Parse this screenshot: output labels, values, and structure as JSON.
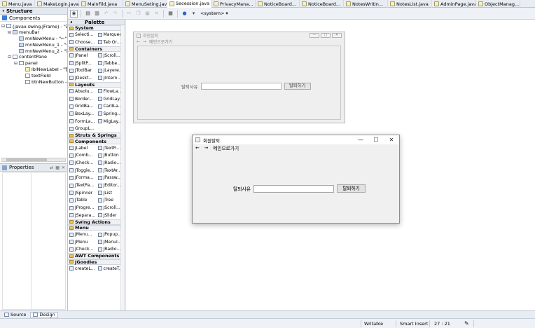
{
  "editor_tabs": [
    "Menu.java",
    "MakeLogin.java",
    "MainFild.java",
    "MenuSeting.java",
    "Secession.java",
    "PrivacyMana...",
    "NoticeBoard...",
    "NoticeBoard...",
    "NotesWritin...",
    "NotesList.java",
    "AdminPage.java",
    "ObjectManag..."
  ],
  "active_tab_close": "✕",
  "structure": {
    "title": "Structure",
    "components_label": "Components",
    "tree": [
      {
        "label": "(javax.swing.JFrame) - \"회원",
        "indent": 0,
        "exp": "⊟",
        "kind": "frame"
      },
      {
        "label": "menuBar",
        "indent": 1,
        "exp": "⊟",
        "kind": "menu"
      },
      {
        "label": "mnNewMenu - \"←\"",
        "indent": 2,
        "exp": "",
        "kind": "menu"
      },
      {
        "label": "mnNewMenu_1 - \"→\"",
        "indent": 2,
        "exp": "",
        "kind": "menu"
      },
      {
        "label": "mnNewMenu_2 - \"메인",
        "indent": 2,
        "exp": "",
        "kind": "menu"
      },
      {
        "label": "contentPane",
        "indent": 1,
        "exp": "⊟",
        "kind": "panel"
      },
      {
        "label": "panel",
        "indent": 2,
        "exp": "⊟",
        "kind": "panel"
      },
      {
        "label": "lblNewLabel - \"탈퇴",
        "indent": 3,
        "exp": "",
        "kind": "lbl"
      },
      {
        "label": "textField",
        "indent": 3,
        "exp": "",
        "kind": "panel"
      },
      {
        "label": "btnNewButton - \"탈",
        "indent": 3,
        "exp": "",
        "kind": "panel"
      }
    ]
  },
  "properties": {
    "title": "Properties"
  },
  "toolbar": {
    "system_label": "<system>"
  },
  "palette": {
    "title": "Palette",
    "categories": [
      {
        "name": "System",
        "items": [
          "Selecti...",
          "Marquee",
          "Choose...",
          "Tab Or..."
        ]
      },
      {
        "name": "Containers",
        "items": [
          "JPanel",
          "JScroll...",
          "JSplitP...",
          "JTabbe...",
          "JToolBar",
          "JLayere...",
          "JDeskt...",
          "JIntern..."
        ]
      },
      {
        "name": "Layouts",
        "items": [
          "Absolu...",
          "FlowLa...",
          "Border...",
          "GridLay...",
          "GridBa...",
          "CardLa...",
          "BoxLay...",
          "Spring...",
          "FormLa...",
          "MigLay...",
          "GroupL..."
        ]
      },
      {
        "name": "Struts & Springs",
        "items": []
      },
      {
        "name": "Components",
        "items": [
          "JLabel",
          "JTextFi...",
          "JComb...",
          "JButton",
          "JCheck...",
          "JRadio...",
          "JToggle...",
          "JTextAr...",
          "JForma...",
          "JPassw...",
          "JTextPa...",
          "JEditor...",
          "JSpinner",
          "JList",
          "JTable",
          "JTree",
          "JProgre...",
          "JScroll...",
          "JSepara...",
          "JSlider"
        ]
      },
      {
        "name": "Swing Actions",
        "items": []
      },
      {
        "name": "Menu",
        "items": [
          "JMenu...",
          "JPopup...",
          "JMenu",
          "JMenuI...",
          "JCheck...",
          "JRadio..."
        ]
      },
      {
        "name": "AWT Components",
        "items": []
      },
      {
        "name": "JGoodies",
        "items": [
          "createL...",
          "createT..."
        ]
      }
    ]
  },
  "design_frame": {
    "title": "회원탈퇴",
    "menu_back": "←",
    "menu_forward": "→",
    "menu_main": "메인으로가기",
    "label": "탈퇴사유",
    "button": "탈퇴하기",
    "ctrl_min": "—",
    "ctrl_max": "□",
    "ctrl_close": "✕"
  },
  "run_window": {
    "title": "회원탈퇴",
    "menu_back": "←",
    "menu_forward": "→",
    "menu_main": "메인으로가기",
    "label": "탈퇴사유",
    "button": "탈퇴하기",
    "ctrl_min": "—",
    "ctrl_max": "☐",
    "ctrl_close": "✕"
  },
  "bottom_tabs": [
    "Source",
    "Design"
  ],
  "status": {
    "mode": "Writable",
    "insert": "Smart Insert",
    "position": "27 : 21"
  }
}
